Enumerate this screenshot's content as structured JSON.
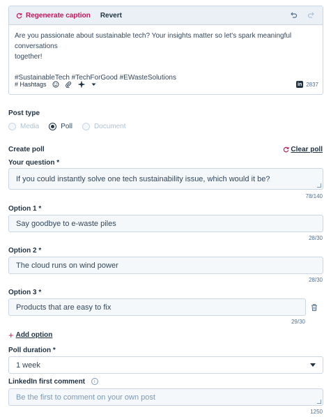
{
  "editor": {
    "regenerate_label": "Regenerate caption",
    "revert_label": "Revert",
    "caption_line1": "Are you passionate about sustainable tech? Your insights matter so let's spark meaningful conversations",
    "caption_line2": "together!",
    "hashtags_line": "#SustainableTech #TechForGood #EWasteSolutions",
    "hashtags_button": "# Hashtags",
    "char_count": "2837"
  },
  "post_type": {
    "label": "Post type",
    "options": [
      "Media",
      "Poll",
      "Document"
    ],
    "selected": "Poll"
  },
  "poll": {
    "label": "Create poll",
    "clear_label": "Clear poll",
    "question_label": "Your question *",
    "question_value": "If you could instantly solve one tech sustainability issue, which would it be?",
    "question_count": "78/140",
    "option1_label": "Option 1 *",
    "option1_value": "Say goodbye to e-waste piles",
    "option1_count": "28/30",
    "option2_label": "Option 2 *",
    "option2_value": "The cloud runs on wind power",
    "option2_count": "28/30",
    "option3_label": "Option 3 *",
    "option3_value": "Products that are easy to fix",
    "option3_count": "29/30",
    "add_option_label": "Add option",
    "duration_label": "Poll duration *",
    "duration_value": "1 week"
  },
  "comment": {
    "label": "LinkedIn first comment",
    "placeholder": "Be the first to comment on your own post",
    "count": "1250"
  },
  "colors": {
    "accent": "#c2185b",
    "text": "#33475b",
    "border": "#cbd6e2"
  }
}
